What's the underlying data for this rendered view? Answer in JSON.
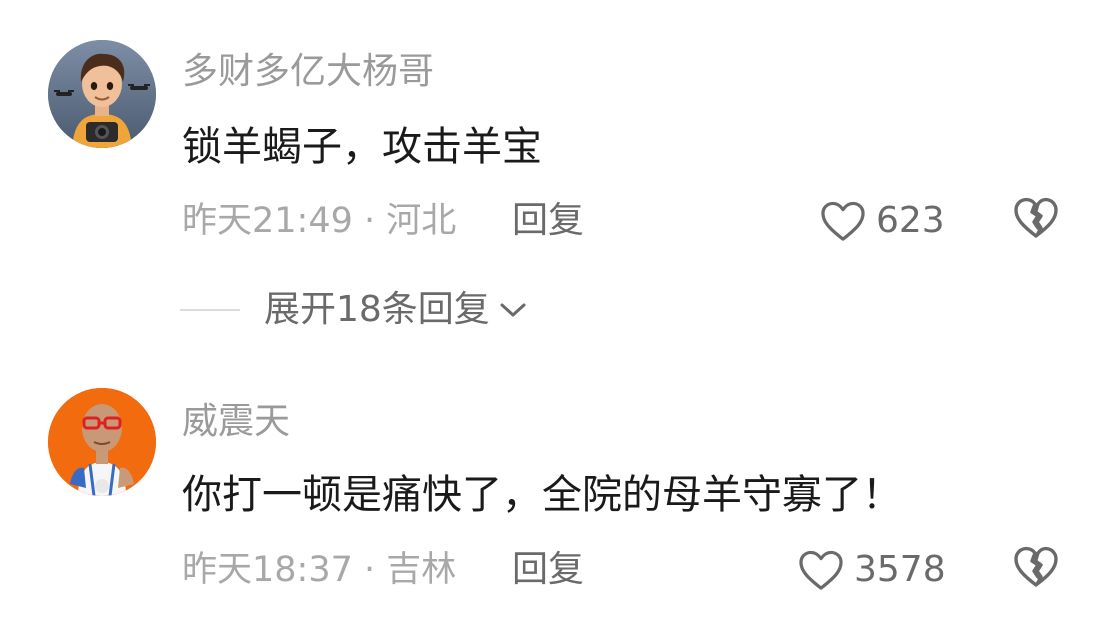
{
  "comments": [
    {
      "username": "多财多亿大杨哥",
      "text": "锁羊蝎子，攻击羊宝",
      "time_location": "昨天21:49 · 河北",
      "reply_label": "回复",
      "like_count": "623",
      "avatar_icon": "boy-with-camera-avatar",
      "replies_toggle": "展开18条回复"
    },
    {
      "username": "威震天",
      "text": "你打一顿是痛快了，全院的母羊守寡了！",
      "time_location": "昨天18:37 · 吉林",
      "reply_label": "回复",
      "like_count": "3578",
      "avatar_icon": "old-man-basketball-avatar"
    }
  ],
  "icons": {
    "like": "heart-outline-icon",
    "dislike": "broken-heart-icon",
    "expand": "chevron-down-icon"
  },
  "colors": {
    "username": "#9a9a9a",
    "text": "#1a1a1a",
    "meta": "#a8a8a8",
    "action": "#6a6a6a",
    "avatar2_bg": "#f26b0f"
  }
}
